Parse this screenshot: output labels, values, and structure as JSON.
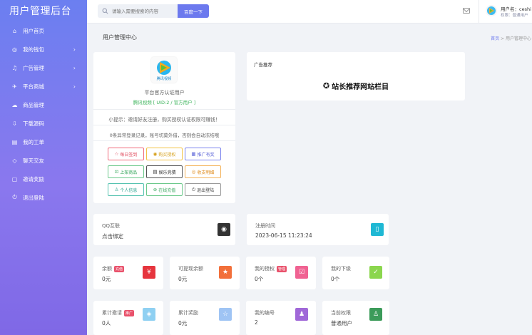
{
  "sidebar": {
    "brand": "用户管理后台",
    "items": [
      {
        "label": "用户首页",
        "icon": "home-icon",
        "glyph": "⌂",
        "chevron": false
      },
      {
        "label": "我的钱包",
        "icon": "wallet-icon",
        "glyph": "◎",
        "chevron": true
      },
      {
        "label": "广告管理",
        "icon": "bell-icon",
        "glyph": "♫",
        "chevron": true
      },
      {
        "label": "平台商城",
        "icon": "rocket-icon",
        "glyph": "✈",
        "chevron": true
      },
      {
        "label": "商品管理",
        "icon": "cloud-icon",
        "glyph": "☁",
        "chevron": false
      },
      {
        "label": "下载源码",
        "icon": "download-icon",
        "glyph": "⇩",
        "chevron": false
      },
      {
        "label": "我的工单",
        "icon": "document-icon",
        "glyph": "▤",
        "chevron": false
      },
      {
        "label": "聊天交友",
        "icon": "tag-icon",
        "glyph": "◇",
        "chevron": false
      },
      {
        "label": "邀请奖励",
        "icon": "lock-icon",
        "glyph": "▢",
        "chevron": false
      },
      {
        "label": "退出登陆",
        "icon": "power-icon",
        "glyph": "⏻",
        "chevron": false
      }
    ]
  },
  "header": {
    "search_placeholder": "请输入需要搜索的内容",
    "search_button": "百度一下",
    "user_name": "用户名：ceshi",
    "user_role": "权限：普通用户"
  },
  "page": {
    "title": "用户管理中心",
    "breadcrumb_home": "首页",
    "breadcrumb_sep": " > ",
    "breadcrumb_current": "用户管理中心"
  },
  "profile": {
    "subtitle": "平台官方认证用户",
    "uid_line": "腾讯视频 [ UID:2 / 官方用户 ]",
    "tip": "小提示：邀请好友注册，购买授权认证权限可赚钱！",
    "warning": "0条异常登录记录，账号切莫外借，否则会自动冻结哦",
    "buttons": [
      {
        "label": "每日签到",
        "glyph": "☆",
        "style": "b-red"
      },
      {
        "label": "购买授权",
        "glyph": "◉",
        "style": "b-yellow"
      },
      {
        "label": "推广有奖",
        "glyph": "▦",
        "style": "b-blue"
      },
      {
        "label": "上架商品",
        "glyph": "⊡",
        "style": "b-green"
      },
      {
        "label": "娱乐竞猜",
        "glyph": "▤",
        "style": "b-dark"
      },
      {
        "label": "收支明细",
        "glyph": "◎",
        "style": "b-orange"
      },
      {
        "label": "个人信息",
        "glyph": "♙",
        "style": "b-teal"
      },
      {
        "label": "在线充值",
        "glyph": "⊛",
        "style": "b-green"
      },
      {
        "label": "退出登陆",
        "glyph": "⏻",
        "style": "b-gray"
      }
    ]
  },
  "ad": {
    "title": "广告推荐",
    "banner": "站长推荐网站栏目"
  },
  "stats": [
    {
      "label": "QQ互联",
      "value": "点击绑定",
      "badge": "",
      "icon": "qq-icon",
      "glyph": "◉",
      "color": "#333333"
    },
    {
      "label": "注册时间",
      "value": "2023-06-15 11:23:24",
      "badge": "",
      "icon": "tablet-icon",
      "glyph": "▯",
      "color": "#1fb8d4"
    },
    {
      "label": "余额",
      "value": "0元",
      "badge": "充值",
      "badge_color": "#e9516b",
      "icon": "yen-icon",
      "glyph": "¥",
      "color": "#e6353e"
    },
    {
      "label": "可提现余额",
      "value": "0元",
      "badge": "",
      "icon": "star-icon",
      "glyph": "★",
      "color": "#f26f3a"
    },
    {
      "label": "我的授权",
      "value": "0个",
      "badge": "管理",
      "badge_color": "#e9516b",
      "icon": "check-doc-icon",
      "glyph": "☑",
      "color": "#f06292"
    },
    {
      "label": "我的下级",
      "value": "0个",
      "badge": "",
      "icon": "check-circle-icon",
      "glyph": "✓",
      "color": "#8bd64e"
    },
    {
      "label": "累计邀请",
      "value": "0人",
      "badge": "推广",
      "badge_color": "#e9516b",
      "icon": "cube-icon",
      "glyph": "◈",
      "color": "#8fd0f2"
    },
    {
      "label": "累计奖励",
      "value": "0元",
      "badge": "",
      "icon": "star-outline-icon",
      "glyph": "☆",
      "color": "#9fc4f4"
    },
    {
      "label": "我的编号",
      "value": "2",
      "badge": "",
      "icon": "user-icon",
      "glyph": "♟",
      "color": "#a068d8"
    },
    {
      "label": "当前权限",
      "value": "普通用户",
      "badge": "",
      "icon": "person-icon",
      "glyph": "♙",
      "color": "#3c9b5a"
    }
  ]
}
